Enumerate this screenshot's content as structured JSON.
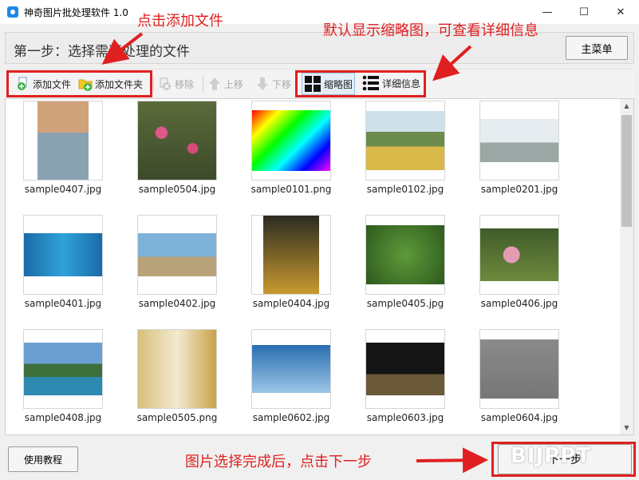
{
  "window": {
    "title": "神奇图片批处理软件 1.0",
    "minimize": "—",
    "maximize": "☐",
    "close": "✕"
  },
  "step": {
    "text": "第一步：选择需要处理的文件",
    "main_menu": "主菜单"
  },
  "toolbar": {
    "add_file": "添加文件",
    "add_folder": "添加文件夹",
    "remove": "移除",
    "move_up": "上移",
    "move_down": "下移",
    "thumbnails": "缩略图",
    "details": "详细信息"
  },
  "files": [
    "sample0407.jpg",
    "sample0504.jpg",
    "sample0101.png",
    "sample0102.jpg",
    "sample0201.jpg",
    "sample0401.jpg",
    "sample0402.jpg",
    "sample0404.jpg",
    "sample0405.jpg",
    "sample0406.jpg",
    "sample0408.jpg",
    "sample0505.png",
    "sample0602.jpg",
    "sample0603.jpg",
    "sample0604.jpg"
  ],
  "bottom": {
    "tutorial": "使用教程",
    "next": "下一步"
  },
  "annotations": {
    "add_files_hint": "点击添加文件",
    "view_hint": "默认显示缩略图，可查看详细信息",
    "next_hint": "图片选择完成后，点击下一步"
  },
  "watermark": "BIJPPT",
  "colors": {
    "annotation": "#e02020",
    "accent": "#1e88e5"
  }
}
